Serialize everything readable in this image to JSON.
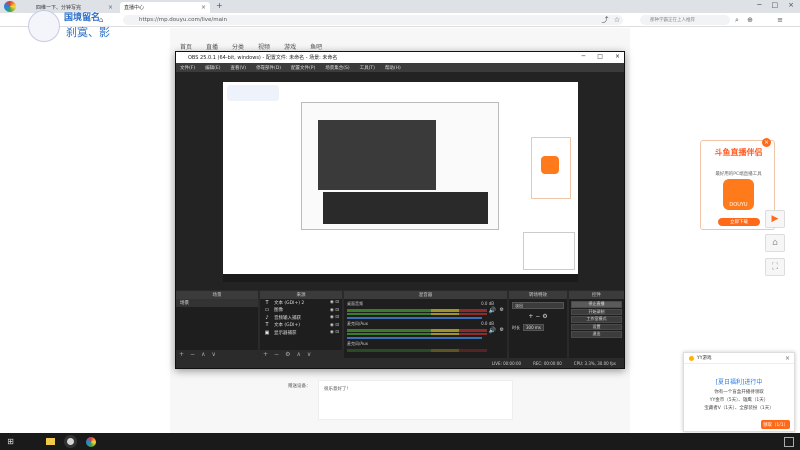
{
  "browser": {
    "tabs": [
      {
        "label": "四维一下、分钟写完"
      },
      {
        "label": "直播中心"
      }
    ],
    "new_tab": "+",
    "url": "https://mp.douyu.com/live/main",
    "search_placeholder": "那种学霸正在上人推荐"
  },
  "page": {
    "nav": [
      "首页",
      "直播",
      "分类",
      "视频",
      "游戏",
      "鱼吧"
    ],
    "gift_label": "赠送设备：",
    "gift_text": "很乐意好了!",
    "overlay": {
      "name": "国境留名",
      "tag": "刹寞、影"
    }
  },
  "obs": {
    "title": "OBS 25.0.1 (64-bit, windows) - 配置文件: 未命名 - 场景: 未命名",
    "menu": [
      "文件(F)",
      "编辑(E)",
      "查看(V)",
      "停靠部件(D)",
      "配置文件(P)",
      "场景集合(S)",
      "工具(T)",
      "帮助(H)"
    ],
    "docks": {
      "scenes": {
        "title": "场景",
        "items": [
          "场景"
        ]
      },
      "sources": {
        "title": "来源",
        "items": [
          {
            "icon": "T",
            "label": "文本 (GDI+) 2"
          },
          {
            "icon": "▭",
            "label": "图像"
          },
          {
            "icon": "♪",
            "label": "音频输入捕获"
          },
          {
            "icon": "T",
            "label": "文本 (GDI+)"
          },
          {
            "icon": "▣",
            "label": "显示器捕获"
          }
        ]
      },
      "mixer": {
        "title": "混音器",
        "tracks": [
          {
            "name": "桌面音频",
            "db": "0.0 dB"
          },
          {
            "name": "麦克风/Aux",
            "db": "0.0 dB"
          },
          {
            "name": "麦克风/Aux",
            "db": ""
          }
        ]
      },
      "transitions": {
        "title": "转场特效",
        "mode": "淡出",
        "duration_label": "时长",
        "duration": "300 ms"
      },
      "controls": {
        "title": "控件",
        "buttons": [
          "停止直播",
          "开始录制",
          "工作室模式",
          "设置",
          "退出"
        ]
      }
    },
    "status": {
      "live": "LIVE: 00:00:00",
      "rec": "REC: 00:00:00",
      "cpu": "CPU: 3.3%, 30.00 fps"
    }
  },
  "promo": {
    "title": "斗鱼直播伴侣",
    "subtitle": "最好用的PC端直播工具",
    "logo_text": "DOUYU",
    "button": "立即下载"
  },
  "notification": {
    "head": "YY游戏",
    "title": "[夏日福利]进行中",
    "lines": [
      "你有一个盲盒开播待领取",
      "YY金币（5天）、雄鹰（1天）",
      "宝藏者V（1天）、全部装扮（1天）"
    ],
    "button": "领取（1/1）"
  },
  "colors": {
    "accent": "#ff5d23",
    "obs_bg": "#2a2a2a",
    "link": "#2b78e4"
  }
}
